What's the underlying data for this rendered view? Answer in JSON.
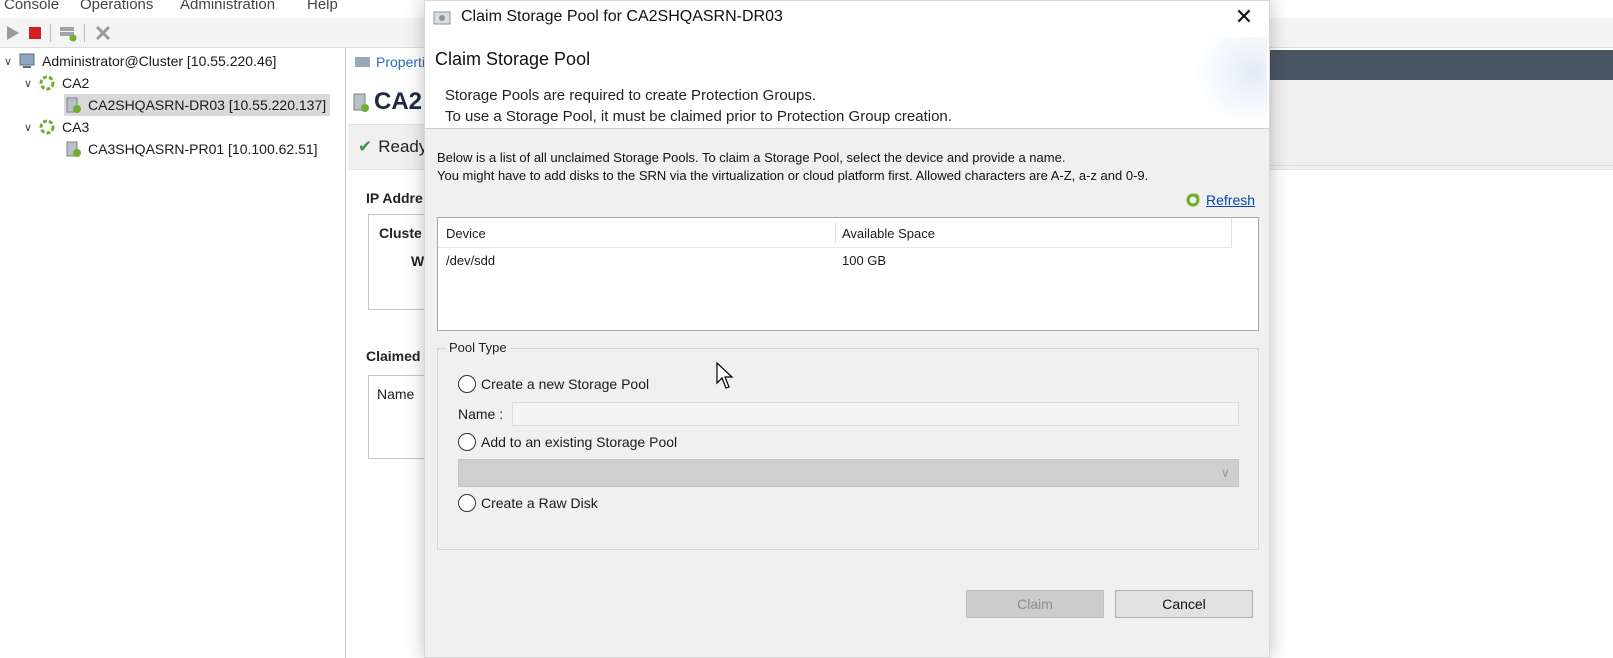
{
  "menubar": {
    "items": [
      "Console",
      "Operations",
      "Administration",
      "Help"
    ]
  },
  "tree": {
    "root_label": "Administrator@Cluster [10.55.220.46]",
    "groups": [
      {
        "label": "CA2",
        "children": [
          "CA2SHQASRN-DR03 [10.55.220.137]"
        ]
      },
      {
        "label": "CA3",
        "children": [
          "CA3SHQASRN-PR01 [10.100.62.51]"
        ]
      }
    ]
  },
  "background_pane": {
    "tab_label": "Propertie",
    "title_fragment": "CA2",
    "status": "Ready",
    "ip_label_fragment": "IP Addre",
    "cluster_label_fragment": "Cluste",
    "w_fragment": "W",
    "claimed_label_fragment": "Claimed",
    "name_column": "Name"
  },
  "dialog": {
    "window_title": "Claim Storage Pool for CA2SHQASRN-DR03",
    "header_title": "Claim Storage Pool",
    "header_line1": "Storage Pools are required to create Protection Groups.",
    "header_line2": "To use a Storage Pool, it must be claimed prior to Protection Group creation.",
    "instruction_line1": "Below is a list of all unclaimed Storage Pools. To claim a Storage Pool, select the device and provide a name.",
    "instruction_line2": "You might have to add disks to the SRN via the virtualization or cloud platform first. Allowed characters are A-Z, a-z and 0-9.",
    "refresh_label": "Refresh",
    "table": {
      "columns": [
        "Device",
        "Available Space"
      ],
      "rows": [
        {
          "device": "/dev/sdd",
          "available_space": "100 GB"
        }
      ]
    },
    "pool_type": {
      "legend": "Pool Type",
      "option_new": "Create a new Storage Pool",
      "name_label": "Name :",
      "name_value": "",
      "option_existing": "Add to an existing Storage Pool",
      "existing_selected": "",
      "option_raw": "Create a Raw Disk"
    },
    "buttons": {
      "claim": "Claim",
      "cancel": "Cancel"
    }
  },
  "colors": {
    "link": "#0645ad",
    "dialog_bg": "#f0f0f0",
    "dark_bar": "#4a5562"
  }
}
